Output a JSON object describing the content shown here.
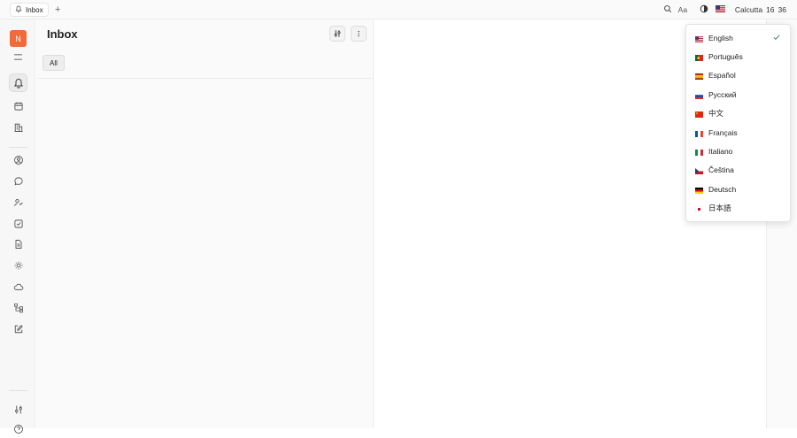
{
  "topbar": {
    "tab_label": "Inbox",
    "new_tab_symbol": "+",
    "font_toggle": "Aa",
    "timezone": "Calcutta",
    "time_hour": "16",
    "time_minute": "36"
  },
  "sidebar": {
    "avatar_initial": "N",
    "icons": [
      "menu-icon",
      "bell-icon",
      "calendar-icon",
      "building-icon",
      "user-circle-icon",
      "chat-icon",
      "users-icon",
      "checkbox-icon",
      "document-icon",
      "sun-icon",
      "cloud-icon",
      "workflow-icon",
      "edit-icon",
      "sliders-icon",
      "help-icon"
    ]
  },
  "inbox": {
    "title": "Inbox",
    "filter_all": "All"
  },
  "language_menu": {
    "items": [
      {
        "label": "English",
        "flag": "us",
        "selected": true
      },
      {
        "label": "Português",
        "flag": "pt",
        "selected": false
      },
      {
        "label": "Español",
        "flag": "es",
        "selected": false
      },
      {
        "label": "Русский",
        "flag": "ru",
        "selected": false
      },
      {
        "label": "中文",
        "flag": "cn",
        "selected": false
      },
      {
        "label": "Français",
        "flag": "fr",
        "selected": false
      },
      {
        "label": "Italiano",
        "flag": "it",
        "selected": false
      },
      {
        "label": "Čeština",
        "flag": "cz",
        "selected": false
      },
      {
        "label": "Deutsch",
        "flag": "de",
        "selected": false
      },
      {
        "label": "日本語",
        "flag": "jp",
        "selected": false
      }
    ]
  },
  "colors": {
    "avatar": "#f06a3a",
    "accent_check": "#2e7d5b"
  }
}
